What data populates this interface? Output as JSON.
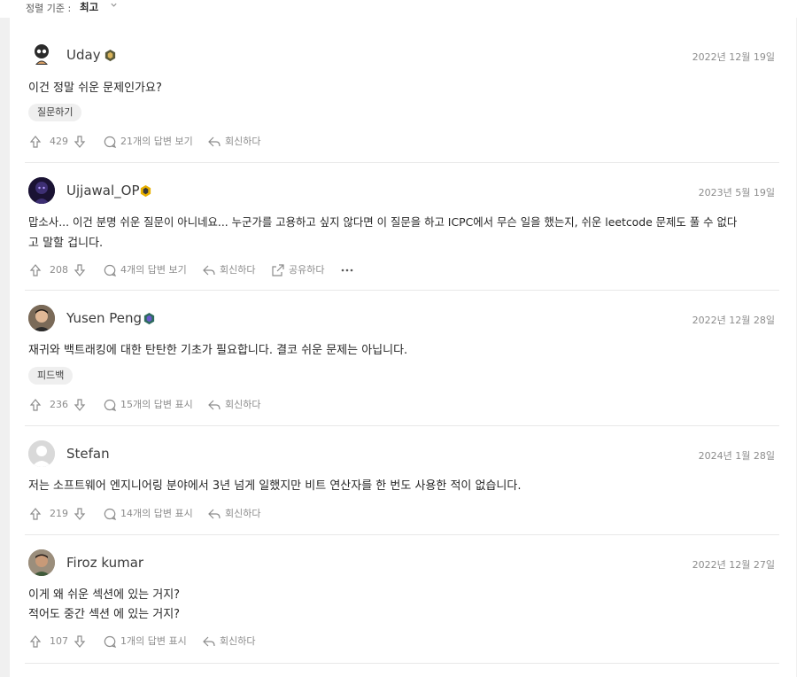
{
  "sort": {
    "label": "정렬 기준 :",
    "value": "최고"
  },
  "comments": [
    {
      "username": "Uday",
      "date": "2022년 12월 19일",
      "lines": [
        "이건 정말 쉬운 문제인가요?"
      ],
      "tag": "질문하기",
      "votes": "429",
      "replies": "21개의 답변 보기",
      "reply": "회신하다",
      "badge_color": "#8a8a5c"
    },
    {
      "username": "Ujjawal_OP",
      "date": "2023년 5월 19일",
      "lines": [
        "맙소사... 이건 분명 쉬운 질문이 아니네요... 누군가를 고용하고 싶지 않다면 이 질문을 하고 ICPC에서 무슨 일을 했는지, 쉬운 leetcode 문제도 풀 수 없다",
        "고 말할 겁니다."
      ],
      "votes": "208",
      "replies": "4개의 답변 보기",
      "reply": "회신하다",
      "share": "공유하다",
      "badge_color": "#e8b000"
    },
    {
      "username": "Yusen Peng",
      "date": "2022년 12월 28일",
      "lines": [
        "재귀와 백트래킹에 대한 탄탄한 기초가 필요합니다. 결코 쉬운 문제는 아닙니다."
      ],
      "tag": "피드백",
      "votes": "236",
      "replies": "15개의 답변 표시",
      "reply": "회신하다",
      "badge_color": "#2e6b5e"
    },
    {
      "username": "Stefan",
      "date": "2024년 1월 28일",
      "lines": [
        "저는 소프트웨어 엔지니어링 분야에서 3년 넘게 일했지만 비트 연산자를 한 번도 사용한 적이 없습니다."
      ],
      "votes": "219",
      "replies": "14개의 답변 표시",
      "reply": "회신하다"
    },
    {
      "username": "Firoz kumar",
      "date": "2022년 12월 27일",
      "lines": [
        "이게 왜 쉬운 섹션에 있는 거지?",
        "적어도 중간 섹션 에 있는 거지?"
      ],
      "votes": "107",
      "replies": "1개의 답변 표시",
      "reply": "회신하다"
    }
  ]
}
